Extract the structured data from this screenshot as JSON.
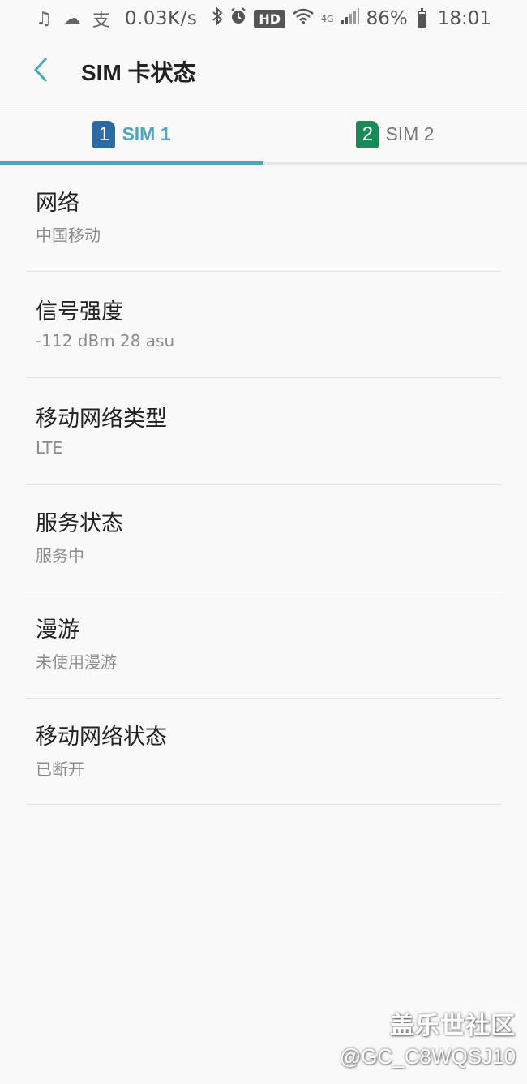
{
  "status_bar": {
    "icons_left": [
      "music-note-icon",
      "weather-icon",
      "alipay-icon"
    ],
    "speed": "0.03K/s",
    "hd_label": "HD",
    "network_small_label": "4G",
    "battery": "86%",
    "battery_level": 0.86,
    "time": "18:01"
  },
  "app_bar": {
    "title": "SIM 卡状态"
  },
  "tabs": [
    {
      "badge": "1",
      "label": "SIM 1",
      "color": "#2c6aa4",
      "active": true
    },
    {
      "badge": "2",
      "label": "SIM 2",
      "color": "#1a8a5b",
      "active": false
    }
  ],
  "items": [
    {
      "title": "网络",
      "value": "中国移动"
    },
    {
      "title": "信号强度",
      "value": "-112 dBm 28 asu"
    },
    {
      "title": "移动网络类型",
      "value": "LTE"
    },
    {
      "title": "服务状态",
      "value": "服务中"
    },
    {
      "title": "漫游",
      "value": "未使用漫游"
    },
    {
      "title": "移动网络状态",
      "value": "已断开"
    }
  ],
  "watermark": {
    "brand": "盖乐世社区",
    "user": "@GC_C8WQSJ10"
  },
  "colors": {
    "accent": "#4ea6bd",
    "sim1": "#2c6aa4",
    "sim2": "#1a8a5b",
    "background": "#f9f9f9"
  }
}
